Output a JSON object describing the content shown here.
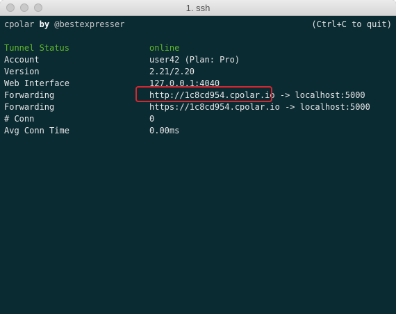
{
  "window": {
    "title": "1. ssh"
  },
  "header": {
    "app": "cpolar",
    "by": "by",
    "author": "@bestexpresser",
    "quit_hint": "(Ctrl+C to quit)"
  },
  "rows": [
    {
      "label": "Tunnel Status",
      "value": "online"
    },
    {
      "label": "Account",
      "value": "user42 (Plan: Pro)"
    },
    {
      "label": "Version",
      "value": "2.21/2.20"
    },
    {
      "label": "Web Interface",
      "value": "127.0.0.1:4040"
    },
    {
      "label": "Forwarding",
      "value": "http://1c8cd954.cpolar.io -> localhost:5000"
    },
    {
      "label": "Forwarding",
      "value": "https://1c8cd954.cpolar.io -> localhost:5000"
    },
    {
      "label": "# Conn",
      "value": "0"
    },
    {
      "label": "Avg Conn Time",
      "value": "0.00ms"
    }
  ],
  "colors": {
    "terminal_background": "#0b2b33",
    "status_green": "#5fb829",
    "highlight_red": "#d7262f"
  }
}
